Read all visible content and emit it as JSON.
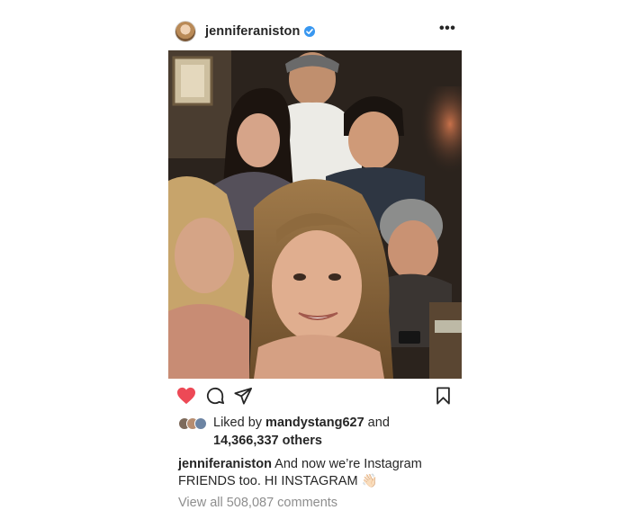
{
  "header": {
    "username": "jenniferaniston",
    "verified": true,
    "more_label": "•••",
    "avatar_icon": "profile-avatar"
  },
  "photo": {
    "description_icon": "group-selfie-photo"
  },
  "actions": {
    "like_icon": "heart-filled-icon",
    "like_color": "#ed4956",
    "comment_icon": "comment-icon",
    "share_icon": "send-icon",
    "save_icon": "bookmark-icon"
  },
  "likes": {
    "prefix": "Liked by ",
    "user": "mandystang627",
    "suffix": " and",
    "others": "14,366,337 others"
  },
  "caption": {
    "username": "jenniferaniston",
    "text": " And now we’re Instagram FRIENDS too. HI INSTAGRAM 👋🏻"
  },
  "comments": {
    "view_all": "View all 508,087 comments"
  },
  "colors": {
    "text": "#262626",
    "muted": "#8e8e8e",
    "verified": "#3897f0"
  }
}
